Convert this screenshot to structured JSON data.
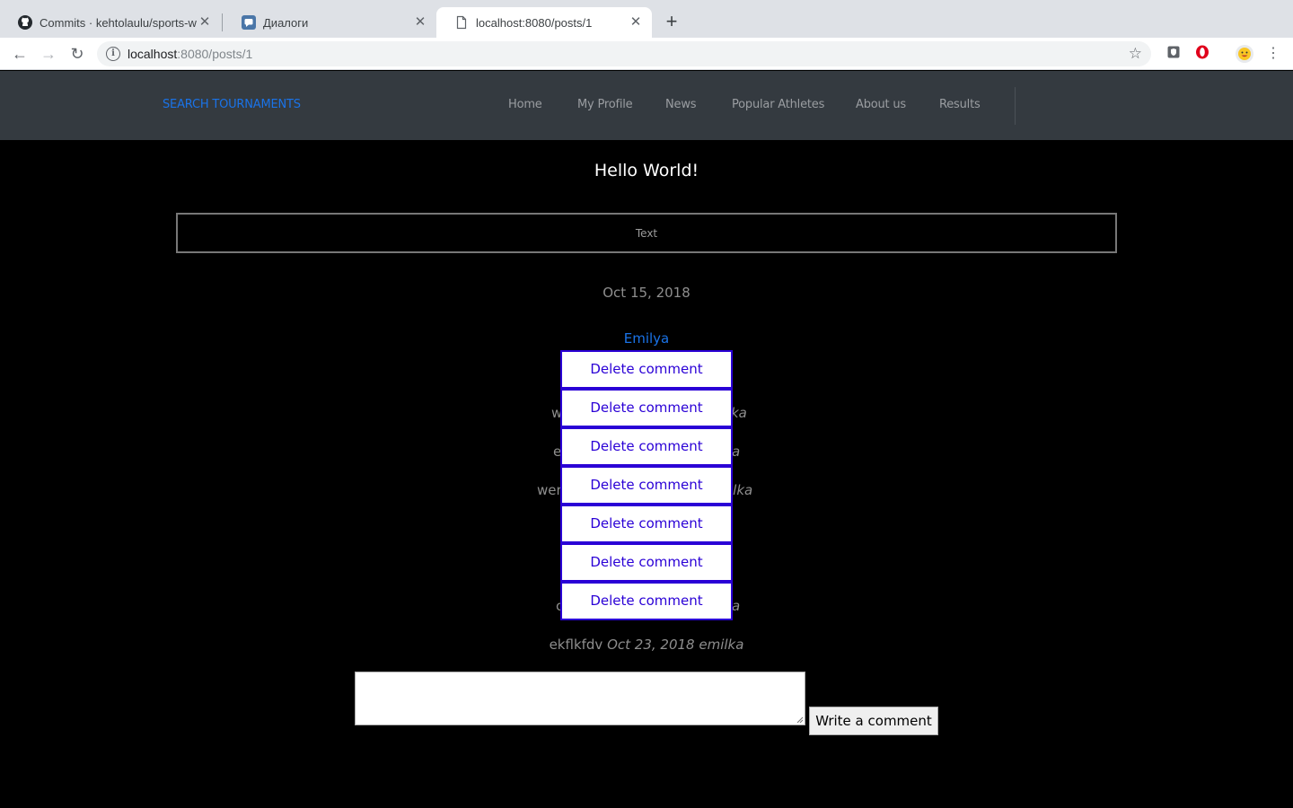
{
  "browser": {
    "tabs": [
      {
        "title": "Commits · kehtolaulu/sports-w",
        "icon": "github-icon"
      },
      {
        "title": "Диалоги",
        "icon": "chat-icon"
      },
      {
        "title": "localhost:8080/posts/1",
        "icon": "page-icon"
      }
    ],
    "active_tab": 2,
    "url_host": "localhost",
    "url_path": ":8080/posts/1"
  },
  "site": {
    "brand": "SEARCH TOURNAMENTS",
    "nav": [
      "Home",
      "My Profile",
      "News",
      "Popular Athletes",
      "About us",
      "Results"
    ]
  },
  "post": {
    "title": "Hello World!",
    "text": "Text",
    "date": "Oct 15, 2018",
    "author": "Emilya"
  },
  "comments": [
    {
      "body": "w",
      "meta": "ka"
    },
    {
      "body": "e",
      "meta": "a"
    },
    {
      "body": "wer",
      "meta": "ilka"
    },
    {
      "body": "c",
      "meta": "a"
    },
    {
      "body": "ekflkfdv",
      "meta": "Oct 23, 2018 emilka"
    }
  ],
  "delete_buttons": [
    "Delete comment",
    "Delete comment",
    "Delete comment",
    "Delete comment",
    "Delete comment",
    "Delete comment",
    "Delete comment"
  ],
  "comment_form": {
    "placeholder": "",
    "submit_label": "Write a comment"
  },
  "colors": {
    "navbar_bg": "#343a40",
    "brand": "#1a73e8",
    "delete_accent": "#2a00d6"
  }
}
